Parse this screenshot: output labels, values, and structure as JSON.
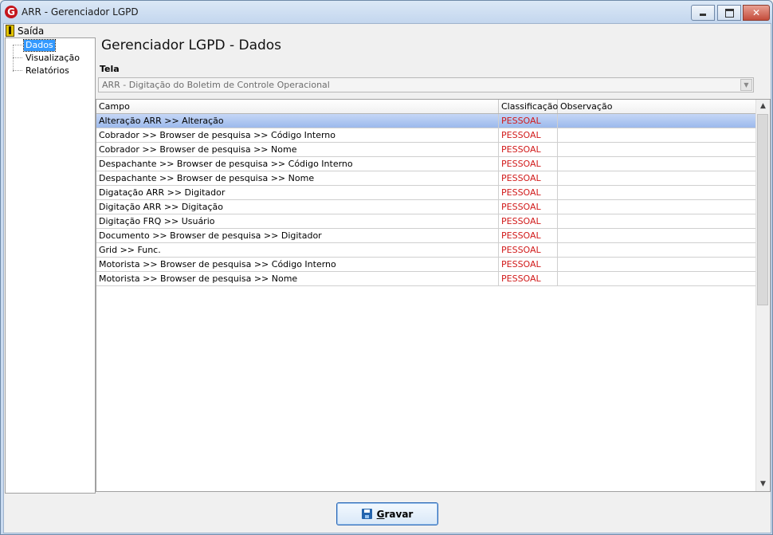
{
  "window": {
    "title": "ARR - Gerenciador LGPD",
    "logo_letter": "G",
    "min_glyph": "",
    "close_glyph": "✕"
  },
  "menu": {
    "exit_label": "Saída"
  },
  "tree": {
    "items": [
      {
        "label": "Dados",
        "selected": true
      },
      {
        "label": "Visualização",
        "selected": false
      },
      {
        "label": "Relatórios",
        "selected": false
      }
    ]
  },
  "main": {
    "title": "Gerenciador LGPD - Dados",
    "tela_label": "Tela",
    "tela_value": "ARR - Digitação do Boletim de Controle Operacional",
    "combo_arrow": "▼"
  },
  "grid": {
    "columns": [
      "Campo",
      "Classificação",
      "Observação"
    ],
    "rows": [
      {
        "campo": "Alteração ARR >> Alteração",
        "classificacao": "PESSOAL",
        "observacao": ""
      },
      {
        "campo": "Cobrador >> Browser de pesquisa >> Código Interno",
        "classificacao": "PESSOAL",
        "observacao": ""
      },
      {
        "campo": "Cobrador >> Browser de pesquisa >> Nome",
        "classificacao": "PESSOAL",
        "observacao": ""
      },
      {
        "campo": "Despachante >> Browser de pesquisa >> Código Interno",
        "classificacao": "PESSOAL",
        "observacao": ""
      },
      {
        "campo": "Despachante >> Browser de pesquisa >> Nome",
        "classificacao": "PESSOAL",
        "observacao": ""
      },
      {
        "campo": "Digatação ARR >> Digitador",
        "classificacao": "PESSOAL",
        "observacao": ""
      },
      {
        "campo": "Digitação ARR >> Digitação",
        "classificacao": "PESSOAL",
        "observacao": ""
      },
      {
        "campo": "Digitação FRQ >> Usuário",
        "classificacao": "PESSOAL",
        "observacao": ""
      },
      {
        "campo": "Documento >> Browser de pesquisa >> Digitador",
        "classificacao": "PESSOAL",
        "observacao": ""
      },
      {
        "campo": "Grid >> Func.",
        "classificacao": "PESSOAL",
        "observacao": ""
      },
      {
        "campo": "Motorista >> Browser de pesquisa >> Código Interno",
        "classificacao": "PESSOAL",
        "observacao": ""
      },
      {
        "campo": "Motorista >> Browser de pesquisa >> Nome",
        "classificacao": "PESSOAL",
        "observacao": ""
      }
    ],
    "selected_row": 0,
    "scroll_up": "▲",
    "scroll_down": "▼"
  },
  "footer": {
    "save_mnemonic": "G",
    "save_rest": "ravar"
  },
  "colors": {
    "accent": "#3399ff",
    "classification_text": "#d11a1a",
    "selected_row": "#9cb9ec"
  }
}
